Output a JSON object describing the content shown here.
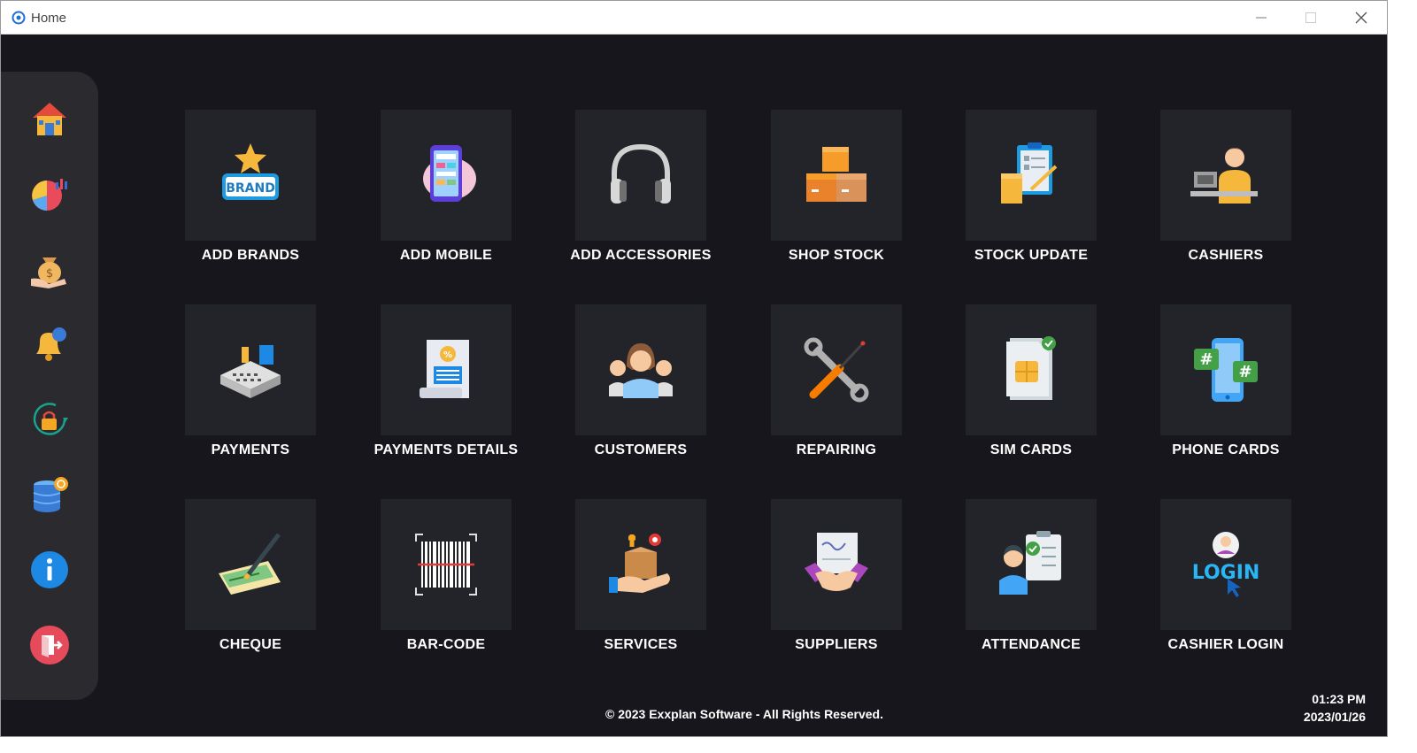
{
  "window": {
    "title": "Home",
    "minimize_icon": "minimize-icon",
    "maximize_icon": "maximize-icon",
    "close_icon": "close-icon"
  },
  "sidebar": {
    "items": [
      {
        "icon": "home-icon"
      },
      {
        "icon": "pie-chart-icon"
      },
      {
        "icon": "money-bag-icon"
      },
      {
        "icon": "notification-bell-icon"
      },
      {
        "icon": "lock-refresh-icon"
      },
      {
        "icon": "database-icon"
      },
      {
        "icon": "info-icon"
      },
      {
        "icon": "exit-icon"
      }
    ]
  },
  "tiles": [
    {
      "label": "ADD BRANDS",
      "icon": "brand-star-icon"
    },
    {
      "label": "ADD MOBILE",
      "icon": "mobile-phone-icon"
    },
    {
      "label": "ADD ACCESSORIES",
      "icon": "headphones-icon"
    },
    {
      "label": "SHOP STOCK",
      "icon": "boxes-icon"
    },
    {
      "label": "STOCK UPDATE",
      "icon": "clipboard-boxes-icon"
    },
    {
      "label": "CASHIERS",
      "icon": "cashier-icon"
    },
    {
      "label": "PAYMENTS",
      "icon": "cash-register-icon"
    },
    {
      "label": "PAYMENTS DETAILS",
      "icon": "receipt-icon"
    },
    {
      "label": "CUSTOMERS",
      "icon": "customers-group-icon"
    },
    {
      "label": "REPAIRING",
      "icon": "wrench-screwdriver-icon"
    },
    {
      "label": "SIM CARDS",
      "icon": "sim-card-icon"
    },
    {
      "label": "PHONE CARDS",
      "icon": "phone-hash-icon"
    },
    {
      "label": "CHEQUE",
      "icon": "cheque-pen-icon"
    },
    {
      "label": "BAR-CODE",
      "icon": "barcode-icon"
    },
    {
      "label": "SERVICES",
      "icon": "service-box-icon"
    },
    {
      "label": "SUPPLIERS",
      "icon": "handshake-icon"
    },
    {
      "label": "ATTENDANCE",
      "icon": "attendance-icon"
    },
    {
      "label": "CASHIER LOGIN",
      "icon": "login-icon"
    }
  ],
  "footer": {
    "copyright": "© 2023 Exxplan Software - All Rights Reserved."
  },
  "clock": {
    "time": "01:23 PM",
    "date": "2023/01/26"
  },
  "colors": {
    "background": "#16161c",
    "tile": "#23232a",
    "sidebar": "#2a2a2f",
    "text": "#ffffff"
  }
}
